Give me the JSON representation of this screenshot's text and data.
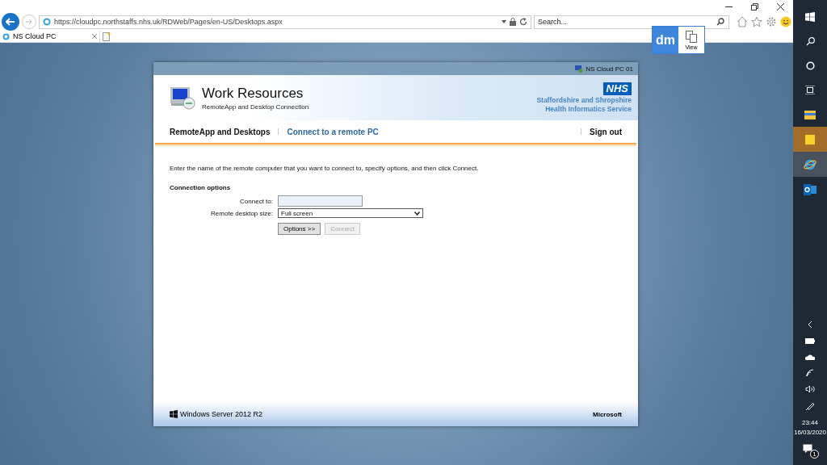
{
  "browser": {
    "url": "https://cloudpc.northstaffs.nhs.uk/RDWeb/Pages/en-US/Desktops.aspx",
    "search": {
      "placeholder": "Search..."
    },
    "tabs": [
      {
        "title": "NS Cloud PC",
        "selected": true
      }
    ]
  },
  "overlay": {
    "logo": "dm",
    "label": "View"
  },
  "page": {
    "computer_name": "NS Cloud PC 01",
    "title": "Work Resources",
    "subtitle": "RemoteApp and Desktop Connection",
    "org_logo": "NHS",
    "org_lines": [
      "Staffordshire and Shropshire",
      "Health Informatics Service"
    ],
    "nav": [
      {
        "label": "RemoteApp and Desktops",
        "selected": false
      },
      {
        "label": "Connect to a remote PC",
        "selected": true
      }
    ],
    "sign_out": "Sign out",
    "instructions": "Enter the name of the remote computer that you want to connect to, specify options, and then click Connect.",
    "section": "Connection options",
    "connect_to": {
      "label": "Connect to:"
    },
    "size": {
      "label": "Remote desktop size:",
      "value": "Full screen"
    },
    "buttons": [
      {
        "label": "Options >>",
        "disabled": false
      },
      {
        "label": "Connect",
        "disabled": true
      }
    ],
    "footer_left": "Windows Server 2012 R2",
    "footer_right": "Microsoft"
  },
  "taskbar": {
    "apps": [
      {
        "kind": "explorer",
        "selected": false
      },
      {
        "kind": "notes",
        "selected": false
      },
      {
        "kind": "ie",
        "selected": true
      },
      {
        "kind": "outlook",
        "selected": false
      }
    ],
    "time": "23:44",
    "date": "16/03/2020",
    "notifications": "1"
  }
}
